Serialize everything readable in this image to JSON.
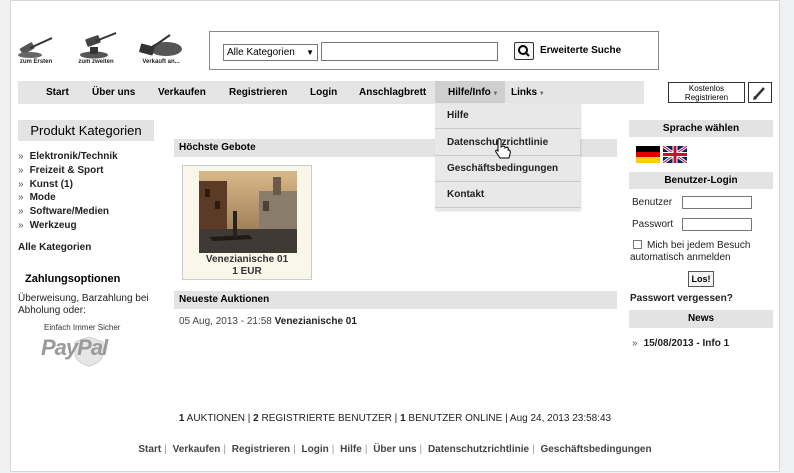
{
  "logos": [
    {
      "label": "zum Ersten"
    },
    {
      "label": "zum zweiten"
    },
    {
      "label": "Verkauft an..."
    }
  ],
  "search": {
    "category_selected": "Alle Kategorien",
    "input_value": "",
    "advanced_label": "Erweiterte Suche"
  },
  "nav": {
    "items": [
      "Start",
      "Über uns",
      "Verkaufen",
      "Registrieren",
      "Login",
      "Anschlagbrett",
      "Hilfe/Info",
      "Links"
    ],
    "dropdown": [
      "Hilfe",
      "Datenschutzrichtlinie",
      "Geschäftsbedingungen",
      "Kontakt"
    ],
    "register_line1": "Kostenlos",
    "register_line2": "Registrieren"
  },
  "left": {
    "title": "Produkt Kategorien",
    "categories": [
      "Elektronik/Technik",
      "Freizeit & Sport",
      "Kunst (1)",
      "Mode",
      "Software/Medien",
      "Werkzeug"
    ],
    "all_categories": "Alle Kategorien",
    "payment_title": "Zahlungsoptionen",
    "payment_text": "Überweisung, Barzahlung bei Abholung oder:",
    "paypal_tagline": "Einfach Immer Sicher",
    "paypal_logo": "PayPal"
  },
  "main": {
    "top_bids_title": "Höchste Gebote",
    "product_name": "Venezianische 01",
    "product_price": "1 EUR",
    "newest_title": "Neueste Auktionen",
    "newest_date": "05 Aug, 2013 - 21:58",
    "newest_item": "Venezianische 01"
  },
  "right": {
    "lang_title": "Sprache wählen",
    "login_title": "Benutzer-Login",
    "user_label": "Benutzer",
    "pass_label": "Passwort",
    "remember_label": "Mich bei jedem Besuch automatisch anmelden",
    "login_button": "Los!",
    "forgot": "Passwort vergessen?",
    "news_title": "News",
    "news_item": "15/08/2013 - Info 1"
  },
  "footer": {
    "stats_auctions_n": "1",
    "stats_auctions": "AUKTIONEN",
    "stats_users_n": "2",
    "stats_users": "REGISTRIERTE BENUTZER",
    "stats_online_n": "1",
    "stats_online": "BENUTZER ONLINE",
    "stats_date": "Aug 24, 2013 23:58:43",
    "links": [
      "Start",
      "Verkaufen",
      "Registrieren",
      "Login",
      "Hilfe",
      "Über uns",
      "Datenschutzrichtlinie",
      "Geschäftsbedingungen"
    ]
  },
  "colors": {
    "header_bg": "#e3e3e3",
    "nav_bg": "#e5e5e5",
    "dropdown_bg": "#e8e8e8"
  }
}
